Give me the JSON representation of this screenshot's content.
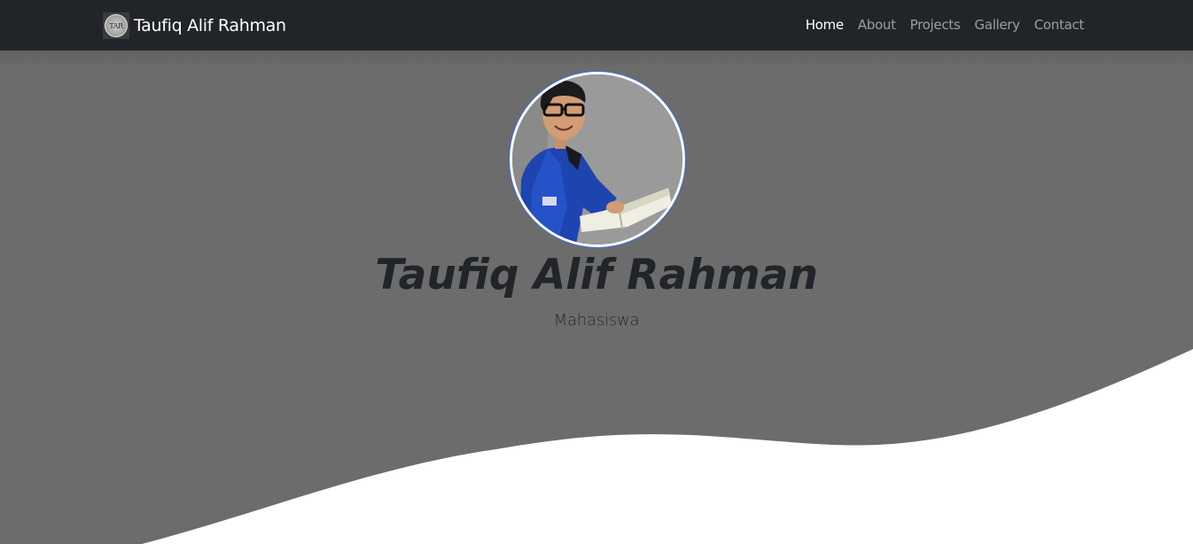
{
  "navbar": {
    "brand_name": "Taufiq Alif Rahman",
    "brand_logo_text": "TAR",
    "links": [
      {
        "label": "Home",
        "active": true
      },
      {
        "label": "About",
        "active": false
      },
      {
        "label": "Projects",
        "active": false
      },
      {
        "label": "Gallery",
        "active": false
      },
      {
        "label": "Contact",
        "active": false
      }
    ]
  },
  "hero": {
    "title": "Taufiq Alif Rahman",
    "subtitle": "Mahasiswa",
    "avatar_icon": "profile-photo"
  },
  "colors": {
    "navbar_bg": "#212529",
    "hero_bg": "#6c6c6c",
    "wave_fill": "#ffffff",
    "title_color": "#212529",
    "avatar_border": "#3d6fd6"
  }
}
